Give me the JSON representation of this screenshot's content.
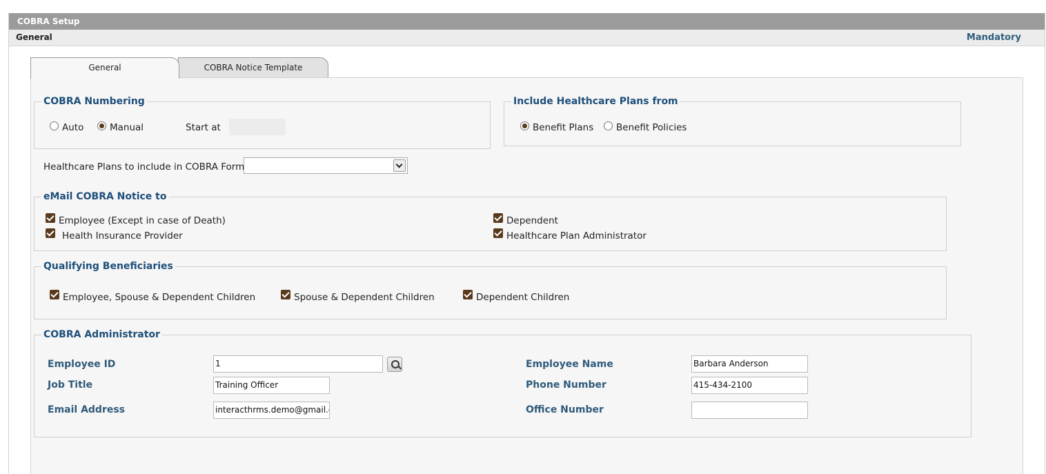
{
  "header": {
    "title": "COBRA Setup",
    "section": "General",
    "mandatory": "Mandatory"
  },
  "tabs": [
    {
      "label": "General",
      "active": true
    },
    {
      "label": "COBRA Notice Template",
      "active": false
    }
  ],
  "numbering": {
    "legend": "COBRA Numbering",
    "auto_label": "Auto",
    "manual_label": "Manual",
    "selected": "Manual",
    "start_at_label": "Start at",
    "start_at_value": ""
  },
  "include_plans": {
    "legend": "Include Healthcare Plans from",
    "benefit_plans_label": "Benefit Plans",
    "benefit_policies_label": "Benefit Policies",
    "selected": "Benefit Plans"
  },
  "plans_form": {
    "label": "Healthcare Plans to include in COBRA Form",
    "value": ""
  },
  "email": {
    "legend": "eMail COBRA Notice to",
    "items": [
      {
        "label": "Employee (Except in case of Death)",
        "checked": true
      },
      {
        "label": "Dependent",
        "checked": true
      },
      {
        "label": "Health Insurance Provider",
        "checked": true
      },
      {
        "label": "Healthcare Plan Administrator",
        "checked": true
      }
    ]
  },
  "beneficiaries": {
    "legend": "Qualifying Beneficiaries",
    "items": [
      {
        "label": "Employee, Spouse & Dependent Children",
        "checked": true
      },
      {
        "label": "Spouse & Dependent Children",
        "checked": true
      },
      {
        "label": "Dependent Children",
        "checked": true
      }
    ]
  },
  "admin": {
    "legend": "COBRA Administrator",
    "employee_id_label": "Employee ID",
    "employee_id": "1",
    "job_title_label": "Job Title",
    "job_title": "Training Officer",
    "email_label": "Email Address",
    "email": "interacthrms.demo@gmail.com",
    "employee_name_label": "Employee Name",
    "employee_name": "Barbara Anderson",
    "phone_label": "Phone Number",
    "phone": "415-434-2100",
    "office_label": "Office Number",
    "office": ""
  },
  "colors": {
    "title_bar": "#9b9b9b",
    "accent_blue": "#1d4f7a",
    "check_brown": "#5b3a1c"
  }
}
